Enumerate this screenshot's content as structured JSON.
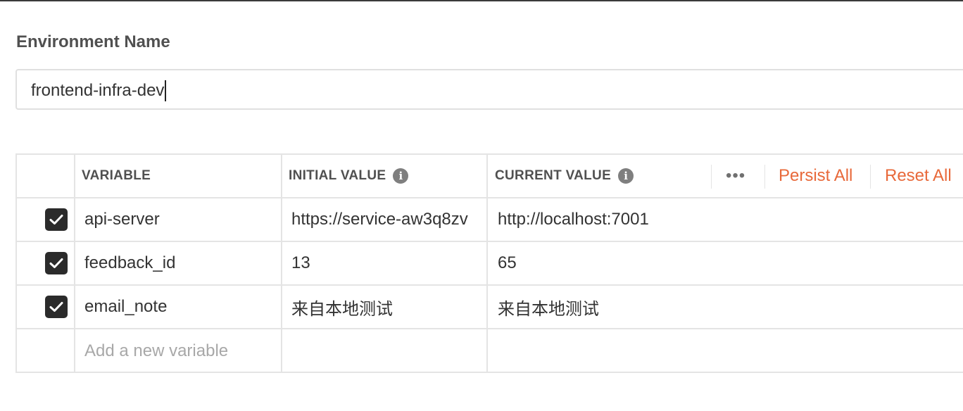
{
  "environment": {
    "label": "Environment Name",
    "name_value": "frontend-infra-dev"
  },
  "table": {
    "headers": {
      "variable": "VARIABLE",
      "initial_value": "INITIAL VALUE",
      "current_value": "CURRENT VALUE"
    },
    "actions": {
      "more": "•••",
      "persist_all": "Persist All",
      "reset_all": "Reset All"
    },
    "rows": [
      {
        "enabled": true,
        "variable": "api-server",
        "initial": "https://service-aw3q8zv",
        "current": "http://localhost:7001"
      },
      {
        "enabled": true,
        "variable": "feedback_id",
        "initial": "13",
        "current": "65"
      },
      {
        "enabled": true,
        "variable": "email_note",
        "initial": "来自本地测试",
        "current": "来自本地测试"
      }
    ],
    "new_variable_placeholder": "Add a new variable"
  },
  "colors": {
    "accent": "#e8693a",
    "checkbox": "#2b2b2b",
    "border": "#e4e4e4"
  }
}
